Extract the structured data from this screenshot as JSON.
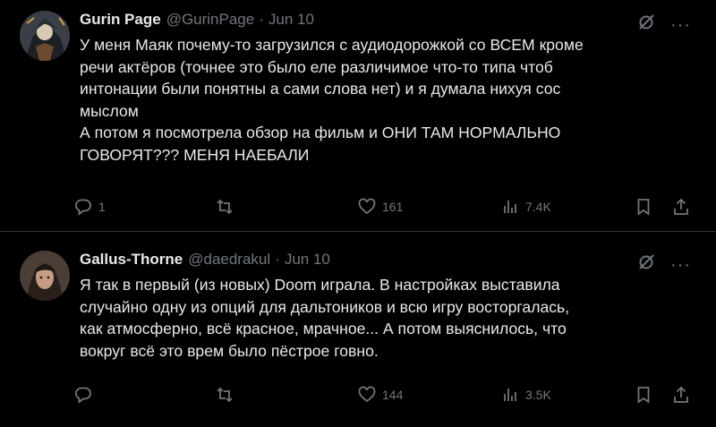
{
  "tweets": [
    {
      "name": "Gurin Page",
      "handle": "@GurinPage",
      "separator": "·",
      "date": "Jun 10",
      "text_lines": [
        "У меня Маяк почему-то загрузился с аудиодорожкой со ВСЕМ кроме",
        "речи актёров (точнее это было еле различимое что-то типа чтоб",
        "интонации были понятны а сами слова нет) и я думала нихуя сос",
        "мыслом",
        "А потом я посмотрела обзор на фильм и ОНИ ТАМ НОРМАЛЬНО",
        "ГОВОРЯТ??? МЕНЯ НАЕБАЛИ"
      ],
      "replies": "1",
      "retweets": "",
      "likes": "161",
      "views": "7.4K",
      "more": "···",
      "grok_icon": "grok-icon"
    },
    {
      "name": "Gallus-Thorne",
      "handle": "@daedrakul",
      "separator": "·",
      "date": "Jun 10",
      "text_lines": [
        "Я так в первый (из новых) Doom играла. В настройках выставила",
        "случайно одну из опций для дальтоников и всю игру восторгалась,",
        "как атмосферно, всё красное, мрачное... А потом выяснилось, что",
        "вокруг всё это врем было пёстрое говно."
      ],
      "replies": "",
      "retweets": "",
      "likes": "144",
      "views": "3.5K",
      "more": "···",
      "grok_icon": "grok-icon"
    }
  ],
  "colors": {
    "background": "#000000",
    "text": "#e7e9ea",
    "muted": "#71767b",
    "divider": "#2f3336"
  }
}
